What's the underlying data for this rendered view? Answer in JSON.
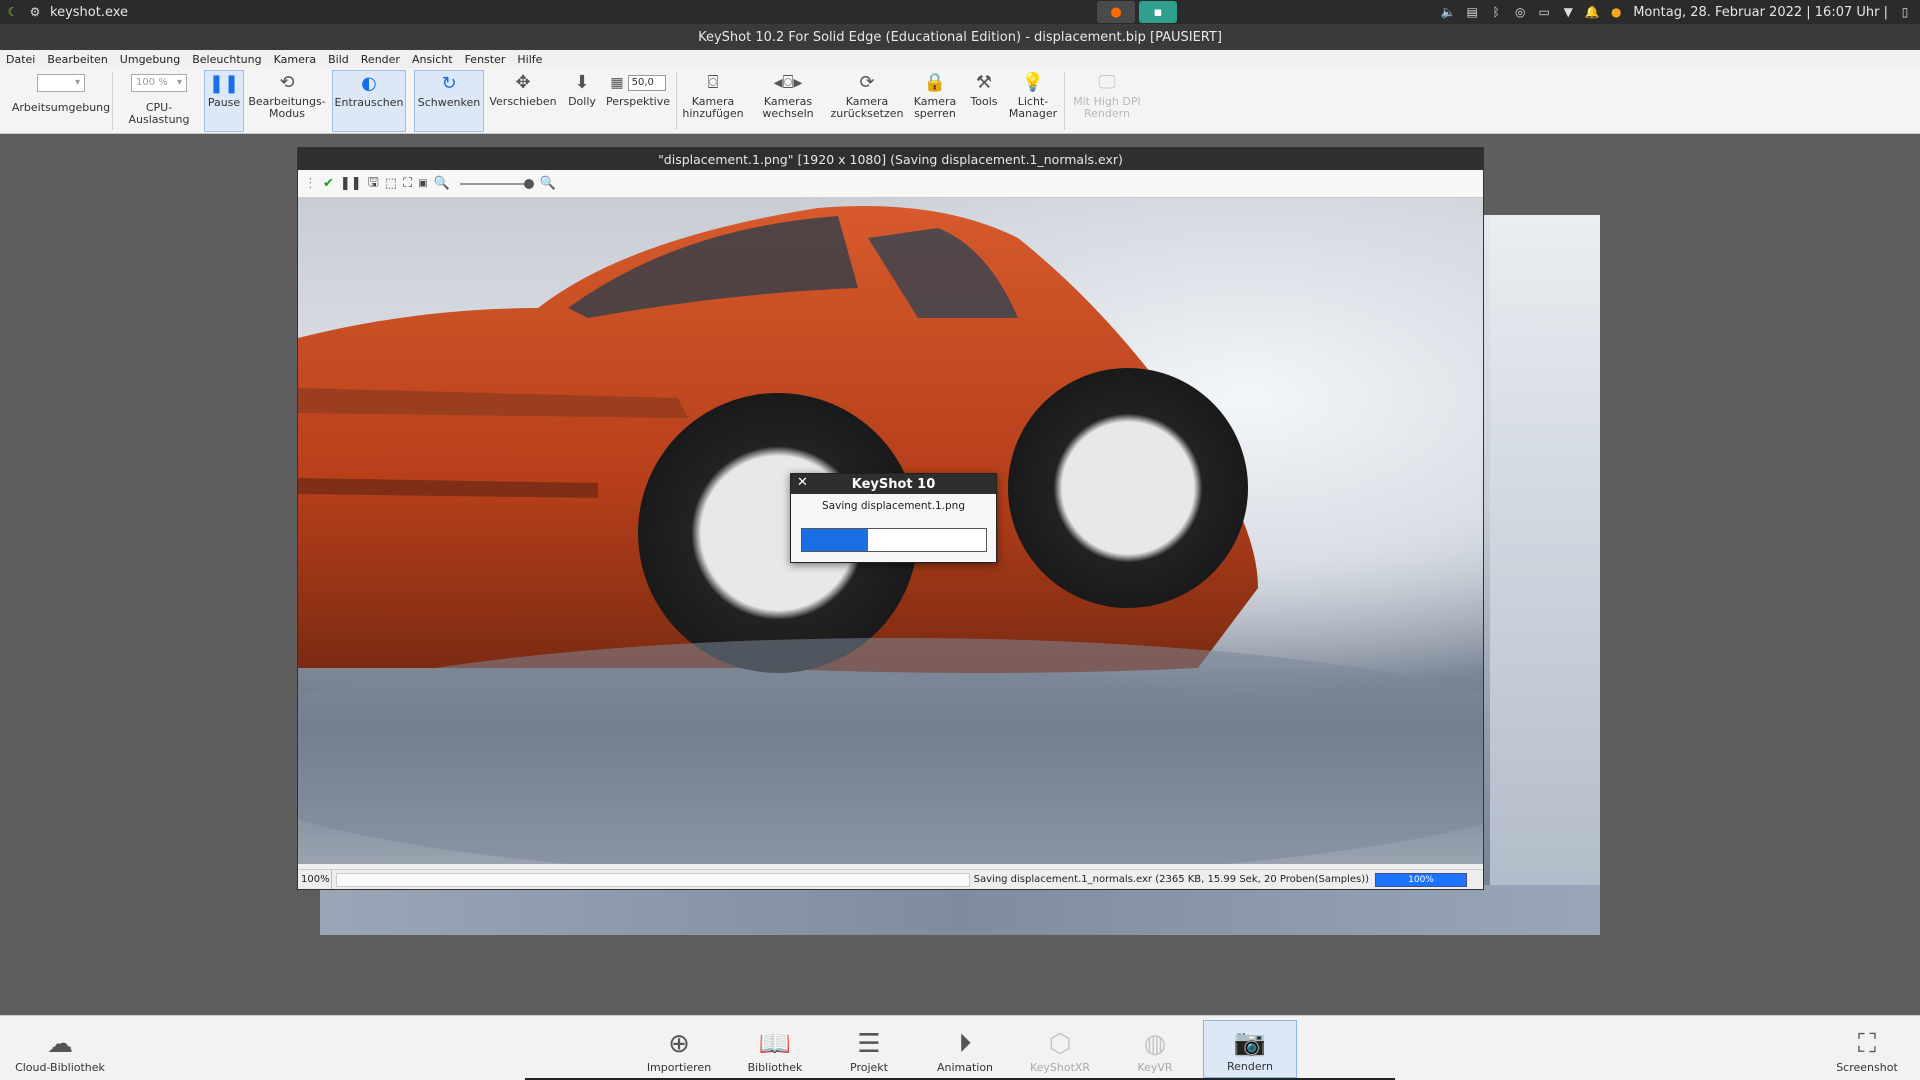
{
  "os": {
    "app_name": "keyshot.exe",
    "datetime": "Montag, 28. Februar 2022 | 16:07 Uhr |"
  },
  "window": {
    "title": "KeyShot 10.2 For Solid Edge (Educational Edition) - displacement.bip [PAUSIERT]"
  },
  "menu": [
    "Datei",
    "Bearbeiten",
    "Umgebung",
    "Beleuchtung",
    "Kamera",
    "Bild",
    "Render",
    "Ansicht",
    "Fenster",
    "Hilfe"
  ],
  "toolbar": {
    "arbeitsumgebung": "Arbeitsumgebung",
    "cpu_value": "100 %",
    "cpu_label": "CPU-Auslastung",
    "pause": "Pause",
    "bearbeitungs": "Bearbeitungs-",
    "modus": "Modus",
    "entrauschen": "Entrauschen",
    "schwenken": "Schwenken",
    "verschieben": "Verschieben",
    "dolly": "Dolly",
    "perspective_value": "50,0",
    "perspektive": "Perspektive",
    "kamera_hinzu_1": "Kamera",
    "kamera_hinzu_2": "hinzufügen",
    "kameras_w_1": "Kameras",
    "kameras_w_2": "wechseln",
    "kamera_zur_1": "Kamera",
    "kamera_zur_2": "zurücksetzen",
    "kamera_sp_1": "Kamera",
    "kamera_sp_2": "sperren",
    "tools": "Tools",
    "licht_1": "Licht-",
    "licht_2": "Manager",
    "hidpi_1": "Mit High DPI",
    "hidpi_2": "Rendern"
  },
  "render_window": {
    "title": "\"displacement.1.png\" [1920 x 1080] (Saving displacement.1_normals.exr)",
    "zoom": "100%",
    "status": "Saving displacement.1_normals.exr (2365 KB, 15.99 Sek, 20 Proben(Samples))",
    "progress_label": "100%",
    "progress": 1.0
  },
  "dialog": {
    "title": "KeyShot 10",
    "close": "✕",
    "message": "Saving displacement.1.png",
    "progress": 0.36
  },
  "bottom": {
    "cloud": "Cloud-Bibliothek",
    "importieren": "Importieren",
    "bibliothek": "Bibliothek",
    "projekt": "Projekt",
    "animation": "Animation",
    "keyshotxr": "KeyShotXR",
    "keyvr": "KeyVR",
    "rendern": "Rendern",
    "screenshot": "Screenshot"
  },
  "colors": {
    "accent": "#1a6fe6",
    "car": "#c9481f",
    "active_bg": "#dce8f6"
  }
}
